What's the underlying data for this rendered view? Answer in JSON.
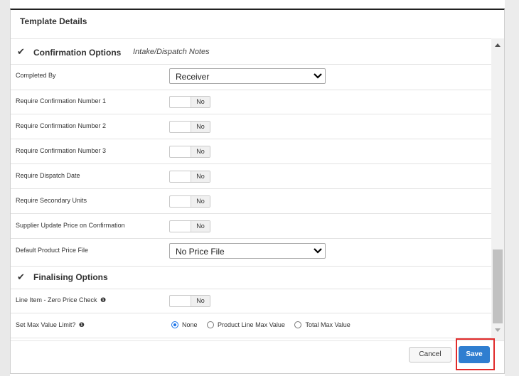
{
  "modal": {
    "title": "Template Details"
  },
  "confirmation": {
    "title": "Confirmation Options",
    "subtitle": "Intake/Dispatch Notes",
    "completed_by": {
      "label": "Completed By",
      "value": "Receiver"
    },
    "toggles": [
      {
        "label": "Require Confirmation Number 1",
        "value": "No"
      },
      {
        "label": "Require Confirmation Number 2",
        "value": "No"
      },
      {
        "label": "Require Confirmation Number 3",
        "value": "No"
      },
      {
        "label": "Require Dispatch Date",
        "value": "No"
      },
      {
        "label": "Require Secondary Units",
        "value": "No"
      },
      {
        "label": "Supplier Update Price on Confirmation",
        "value": "No"
      }
    ],
    "price_file": {
      "label": "Default Product Price File",
      "value": "No Price File"
    }
  },
  "finalising": {
    "title": "Finalising Options",
    "zero_price": {
      "label": "Line Item - Zero Price Check",
      "value": "No"
    },
    "max_value": {
      "label": "Set Max Value Limit?",
      "options": [
        "None",
        "Product Line Max Value",
        "Total Max Value"
      ],
      "selected": "None"
    }
  },
  "footer": {
    "cancel_label": "Cancel",
    "save_label": "Save"
  },
  "colors": {
    "primary": "#2f7ed0",
    "highlight": "#e12b2b",
    "radio_selected": "#1a73e8"
  },
  "icons": {
    "section_check": "checkmark-icon",
    "info": "info-circle-icon",
    "dropdown": "chevron-down-icon"
  }
}
